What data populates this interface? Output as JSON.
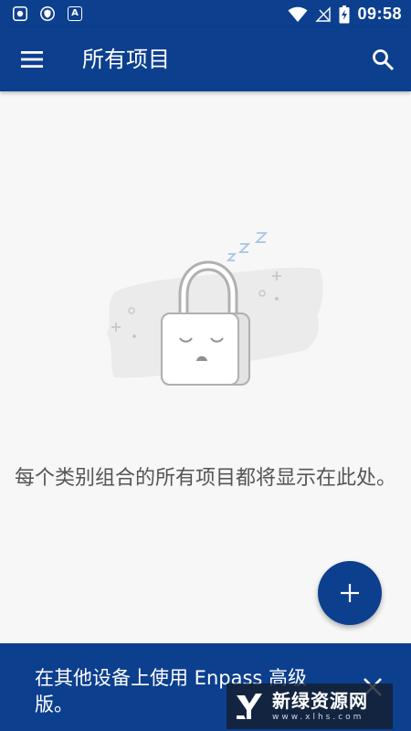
{
  "status_bar": {
    "time": "09:58",
    "left_icons": [
      "vpn-key-icon",
      "shield-app-icon",
      "a-app-icon"
    ],
    "a_icon_letter": "A",
    "right_icons": [
      "wifi-icon",
      "no-sim-icon",
      "battery-charging-icon"
    ]
  },
  "app_bar": {
    "title": "所有项目",
    "menu_icon": "hamburger-menu-icon",
    "search_icon": "search-icon"
  },
  "empty_state": {
    "illustration": "sleeping-padlock",
    "message": "每个类别组合的所有项目都将显示在此处。"
  },
  "fab": {
    "icon": "plus-icon"
  },
  "promo_banner": {
    "text": "在其他设备上使用 Enpass 高级版。",
    "close_icon": "close-icon"
  },
  "watermark": {
    "title": "新绿资源网",
    "url": "www.xlhs.com"
  },
  "colors": {
    "primary": "#0d3f8f",
    "background": "#f7f7f7",
    "text_secondary": "#555555",
    "on_primary": "#ffffff"
  }
}
